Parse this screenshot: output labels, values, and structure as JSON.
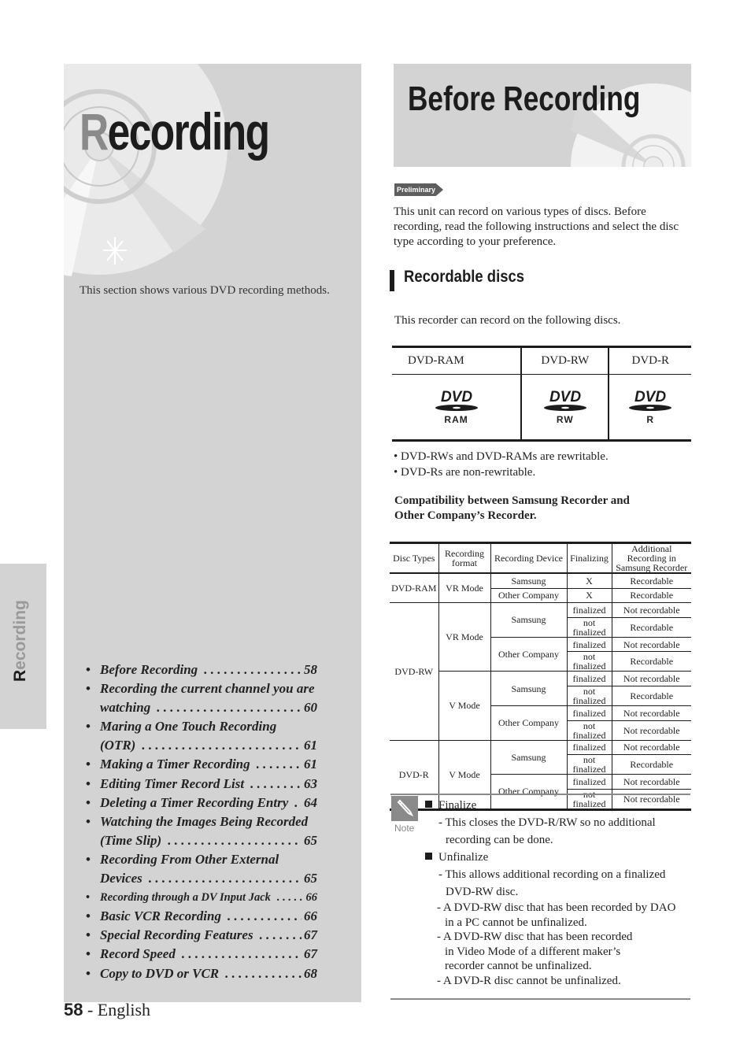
{
  "left": {
    "chapter_title_first": "R",
    "chapter_title_rest": "ecording",
    "description": "This section shows various DVD recording methods.",
    "toc": [
      {
        "lines": [
          "Before Recording"
        ],
        "page": "58"
      },
      {
        "lines": [
          "Recording the current channel you are",
          "watching"
        ],
        "page": "60"
      },
      {
        "lines": [
          "Maring a One Touch Recording",
          "(OTR)"
        ],
        "page": "61"
      },
      {
        "lines": [
          "Making a Timer Recording"
        ],
        "page": "61"
      },
      {
        "lines": [
          "Editing Timer Record List"
        ],
        "page": "63"
      },
      {
        "lines": [
          "Deleting a Timer Recording Entry"
        ],
        "page": "64"
      },
      {
        "lines": [
          "Watching the Images Being Recorded",
          "(Time Slip)"
        ],
        "page": "65"
      },
      {
        "lines": [
          "Recording From Other External",
          "Devices"
        ],
        "page": "65"
      },
      {
        "lines": [
          "Recording through a DV Input Jack"
        ],
        "page": "66"
      },
      {
        "lines": [
          "Basic VCR Recording"
        ],
        "page": "66"
      },
      {
        "lines": [
          "Special Recording Features"
        ],
        "page": "67"
      },
      {
        "lines": [
          "Record Speed"
        ],
        "page": "67"
      },
      {
        "lines": [
          "Copy to DVD or VCR"
        ],
        "page": "68"
      }
    ]
  },
  "side_tab": {
    "label_first": "R",
    "label_rest": "ecording"
  },
  "footer": {
    "page_num": "58",
    "language": " - English"
  },
  "right": {
    "section_title": "Before Recording",
    "badge": "Preliminary",
    "intro": "This unit can record on various types of discs. Before recording, read the following instructions and select the disc type according to your preference.",
    "subhead": "Recordable discs",
    "recorder_text": "This recorder can record on the following discs.",
    "disc_table": {
      "headers": [
        "DVD-RAM",
        "DVD-RW",
        "DVD-R"
      ],
      "logo_word": "DVD",
      "logo_subs": [
        "RAM",
        "RW",
        "R"
      ]
    },
    "bullets": [
      "• DVD-RWs and DVD-RAMs are rewritable.",
      "• DVD-Rs are non-rewritable."
    ],
    "compat_title": "Compatibility between Samsung Recorder and Other Company’s Recorder.",
    "compat_table": {
      "headers": [
        "Disc Types",
        "Recording format",
        "Recording Device",
        "Finalizing",
        "Additional Recording in Samsung Recorder"
      ],
      "rows": [
        {
          "disc": "DVD-RAM",
          "format": "VR Mode",
          "device": "Samsung",
          "finalizing": "X",
          "additional": "Recordable"
        },
        {
          "disc": "DVD-RAM",
          "format": "VR Mode",
          "device": "Other Company",
          "finalizing": "X",
          "additional": "Recordable"
        },
        {
          "disc": "DVD-RW",
          "format": "VR Mode",
          "device": "Samsung",
          "finalizing": "finalized",
          "additional": "Not recordable"
        },
        {
          "disc": "DVD-RW",
          "format": "VR Mode",
          "device": "Samsung",
          "finalizing": "not finalized",
          "additional": "Recordable"
        },
        {
          "disc": "DVD-RW",
          "format": "VR Mode",
          "device": "Other Company",
          "finalizing": "finalized",
          "additional": "Not recordable"
        },
        {
          "disc": "DVD-RW",
          "format": "VR Mode",
          "device": "Other Company",
          "finalizing": "not finalized",
          "additional": "Recordable"
        },
        {
          "disc": "DVD-RW",
          "format": "V Mode",
          "device": "Samsung",
          "finalizing": "finalized",
          "additional": "Not recordable"
        },
        {
          "disc": "DVD-RW",
          "format": "V Mode",
          "device": "Samsung",
          "finalizing": "not finalized",
          "additional": "Recordable"
        },
        {
          "disc": "DVD-RW",
          "format": "V Mode",
          "device": "Other Company",
          "finalizing": "finalized",
          "additional": "Not recordable"
        },
        {
          "disc": "DVD-RW",
          "format": "V Mode",
          "device": "Other Company",
          "finalizing": "not finalized",
          "additional": "Not recordable"
        },
        {
          "disc": "DVD-R",
          "format": "V Mode",
          "device": "Samsung",
          "finalizing": "finalized",
          "additional": "Not recordable"
        },
        {
          "disc": "DVD-R",
          "format": "V Mode",
          "device": "Samsung",
          "finalizing": "not finalized",
          "additional": "Recordable"
        },
        {
          "disc": "DVD-R",
          "format": "V Mode",
          "device": "Other Company",
          "finalizing": "finalized",
          "additional": "Not recordable"
        },
        {
          "disc": "DVD-R",
          "format": "V Mode",
          "device": "Other Company",
          "finalizing": "not finalized",
          "additional": "Not recordable"
        }
      ]
    },
    "note": {
      "label": "Note",
      "lines": [
        {
          "type": "head",
          "text": "Finalize"
        },
        {
          "type": "sub",
          "text": "- This closes the DVD-R/RW so no additional"
        },
        {
          "type": "cont",
          "text": "recording can be done."
        },
        {
          "type": "head",
          "text": "Unfinalize"
        },
        {
          "type": "sub",
          "text": "- This allows additional recording on a finalized"
        },
        {
          "type": "cont",
          "text": "DVD-RW disc."
        },
        {
          "type": "sub2",
          "text": "- A DVD-RW disc that has been recorded by DAO"
        },
        {
          "type": "cont2",
          "text": "in a PC cannot be unfinalized."
        },
        {
          "type": "sub2",
          "text": "- A DVD-RW disc that has been recorded"
        },
        {
          "type": "cont2",
          "text": "in Video Mode of a different maker’s"
        },
        {
          "type": "cont2",
          "text": "recorder cannot be unfinalized."
        },
        {
          "type": "sub2",
          "text": "- A DVD-R disc cannot be unfinalized."
        }
      ]
    }
  }
}
